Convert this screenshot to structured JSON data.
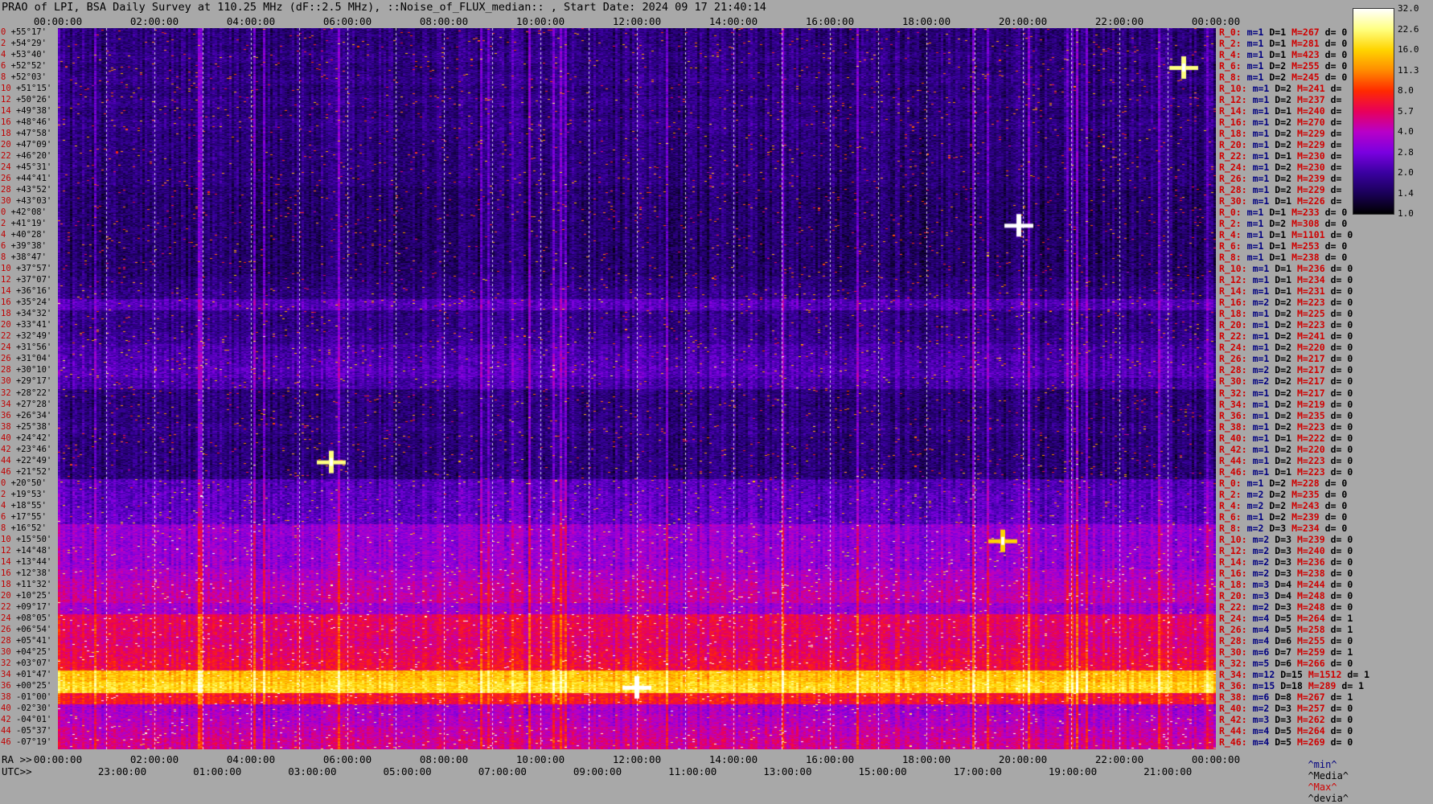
{
  "title": "PRAO of LPI, BSA Daily Survey at 110.25 MHz (dF::2.5 MHz), ::Noise_of_FLUX_median:: , Start Date: 2024 09 17 21:40:14",
  "axis": {
    "ra_label": "RA >>",
    "utc_label": "UTC>>",
    "ra_top_ticks": [
      "00:00:00",
      "02:00:00",
      "04:00:00",
      "06:00:00",
      "08:00:00",
      "10:00:00",
      "12:00:00",
      "14:00:00",
      "16:00:00",
      "18:00:00",
      "20:00:00",
      "22:00:00",
      "00:00:00"
    ],
    "ra_bottom_ticks": [
      "00:00:00",
      "02:00:00",
      "04:00:00",
      "06:00:00",
      "08:00:00",
      "10:00:00",
      "12:00:00",
      "14:00:00",
      "16:00:00",
      "18:00:00",
      "20:00:00",
      "22:00:00",
      "00:00:00"
    ],
    "utc_ticks": [
      "23:00:00",
      "01:00:00",
      "03:00:00",
      "05:00:00",
      "07:00:00",
      "09:00:00",
      "11:00:00",
      "13:00:00",
      "15:00:00",
      "17:00:00",
      "19:00:00",
      "21:00:00"
    ]
  },
  "declinations": [
    "+55°17'",
    "+54°29'",
    "+53°40'",
    "+52°52'",
    "+52°03'",
    "+51°15'",
    "+50°26'",
    "+49°38'",
    "+48°46'",
    "+47°58'",
    "+47°09'",
    "+46°20'",
    "+45°31'",
    "+44°41'",
    "+43°52'",
    "+43°03'",
    "+42°08'",
    "+41°19'",
    "+40°28'",
    "+39°38'",
    "+38°47'",
    "+37°57'",
    "+37°07'",
    "+36°16'",
    "+35°24'",
    "+34°32'",
    "+33°41'",
    "+32°49'",
    "+31°56'",
    "+31°04'",
    "+30°10'",
    "+29°17'",
    "+28°22'",
    "+27°28'",
    "+26°34'",
    "+25°38'",
    "+24°42'",
    "+23°46'",
    "+22°49'",
    "+21°52'",
    "+20°50'",
    "+19°53'",
    "+18°55'",
    "+17°55'",
    "+16°52'",
    "+15°50'",
    "+14°48'",
    "+13°44'",
    "+12°38'",
    "+11°32'",
    "+10°25'",
    "+09°17'",
    "+08°05'",
    "+06°54'",
    "+05°41'",
    "+04°25'",
    "+03°07'",
    "+01°47'",
    "+00°25'",
    "-01°00'",
    "-02°30'",
    "-04°01'",
    "-05°37'",
    "-07°19'"
  ],
  "dec_indices": [
    "0",
    "2",
    "4",
    "6",
    "8",
    "10",
    "12",
    "14",
    "16",
    "18",
    "20",
    "22",
    "24",
    "26",
    "28",
    "30",
    "0",
    "2",
    "4",
    "6",
    "8",
    "10",
    "12",
    "14",
    "16",
    "18",
    "20",
    "22",
    "24",
    "26",
    "28",
    "30",
    "32",
    "34",
    "36",
    "38",
    "40",
    "42",
    "44",
    "46",
    "0",
    "2",
    "4",
    "6",
    "8",
    "10",
    "12",
    "14",
    "16",
    "18",
    "20",
    "22",
    "24",
    "26",
    "28",
    "30",
    "32",
    "34",
    "36",
    "38",
    "40",
    "42",
    "44",
    "46"
  ],
  "stats": [
    {
      "r": "R_0:",
      "m": "m=1",
      "D": "D=1",
      "M": "M=267",
      "d": "d= 0"
    },
    {
      "r": "R_2:",
      "m": "m=1",
      "D": "D=1",
      "M": "M=281",
      "d": "d= 0"
    },
    {
      "r": "R_4:",
      "m": "m=1",
      "D": "D=1",
      "M": "M=423",
      "d": "d= 0"
    },
    {
      "r": "R_6:",
      "m": "m=1",
      "D": "D=2",
      "M": "M=255",
      "d": "d= 0"
    },
    {
      "r": "R_8:",
      "m": "m=1",
      "D": "D=2",
      "M": "M=245",
      "d": "d= 0"
    },
    {
      "r": "R_10:",
      "m": "m=1",
      "D": "D=2",
      "M": "M=241",
      "d": "d="
    },
    {
      "r": "R_12:",
      "m": "m=1",
      "D": "D=2",
      "M": "M=237",
      "d": "d="
    },
    {
      "r": "R_14:",
      "m": "m=1",
      "D": "D=1",
      "M": "M=240",
      "d": "d="
    },
    {
      "r": "R_16:",
      "m": "m=1",
      "D": "D=2",
      "M": "M=270",
      "d": "d="
    },
    {
      "r": "R_18:",
      "m": "m=1",
      "D": "D=2",
      "M": "M=229",
      "d": "d="
    },
    {
      "r": "R_20:",
      "m": "m=1",
      "D": "D=2",
      "M": "M=229",
      "d": "d="
    },
    {
      "r": "R_22:",
      "m": "m=1",
      "D": "D=1",
      "M": "M=230",
      "d": "d="
    },
    {
      "r": "R_24:",
      "m": "m=1",
      "D": "D=2",
      "M": "M=230",
      "d": "d="
    },
    {
      "r": "R_26:",
      "m": "m=1",
      "D": "D=2",
      "M": "M=239",
      "d": "d="
    },
    {
      "r": "R_28:",
      "m": "m=1",
      "D": "D=2",
      "M": "M=229",
      "d": "d="
    },
    {
      "r": "R_30:",
      "m": "m=1",
      "D": "D=1",
      "M": "M=226",
      "d": "d="
    },
    {
      "r": "R_0:",
      "m": "m=1",
      "D": "D=1",
      "M": "M=233",
      "d": "d= 0"
    },
    {
      "r": "R_2:",
      "m": "m=1",
      "D": "D=2",
      "M": "M=308",
      "d": "d= 0"
    },
    {
      "r": "R_4:",
      "m": "m=1",
      "D": "D=1",
      "M": "M=1101",
      "d": "d= 0"
    },
    {
      "r": "R_6:",
      "m": "m=1",
      "D": "D=1",
      "M": "M=253",
      "d": "d= 0"
    },
    {
      "r": "R_8:",
      "m": "m=1",
      "D": "D=1",
      "M": "M=238",
      "d": "d= 0"
    },
    {
      "r": "R_10:",
      "m": "m=1",
      "D": "D=1",
      "M": "M=236",
      "d": "d= 0"
    },
    {
      "r": "R_12:",
      "m": "m=1",
      "D": "D=1",
      "M": "M=234",
      "d": "d= 0"
    },
    {
      "r": "R_14:",
      "m": "m=1",
      "D": "D=1",
      "M": "M=231",
      "d": "d= 0"
    },
    {
      "r": "R_16:",
      "m": "m=2",
      "D": "D=2",
      "M": "M=223",
      "d": "d= 0"
    },
    {
      "r": "R_18:",
      "m": "m=1",
      "D": "D=2",
      "M": "M=225",
      "d": "d= 0"
    },
    {
      "r": "R_20:",
      "m": "m=1",
      "D": "D=2",
      "M": "M=223",
      "d": "d= 0"
    },
    {
      "r": "R_22:",
      "m": "m=1",
      "D": "D=2",
      "M": "M=241",
      "d": "d= 0"
    },
    {
      "r": "R_24:",
      "m": "m=1",
      "D": "D=2",
      "M": "M=220",
      "d": "d= 0"
    },
    {
      "r": "R_26:",
      "m": "m=1",
      "D": "D=2",
      "M": "M=217",
      "d": "d= 0"
    },
    {
      "r": "R_28:",
      "m": "m=2",
      "D": "D=2",
      "M": "M=217",
      "d": "d= 0"
    },
    {
      "r": "R_30:",
      "m": "m=2",
      "D": "D=2",
      "M": "M=217",
      "d": "d= 0"
    },
    {
      "r": "R_32:",
      "m": "m=1",
      "D": "D=2",
      "M": "M=217",
      "d": "d= 0"
    },
    {
      "r": "R_34:",
      "m": "m=1",
      "D": "D=2",
      "M": "M=219",
      "d": "d= 0"
    },
    {
      "r": "R_36:",
      "m": "m=1",
      "D": "D=2",
      "M": "M=235",
      "d": "d= 0"
    },
    {
      "r": "R_38:",
      "m": "m=1",
      "D": "D=2",
      "M": "M=223",
      "d": "d= 0"
    },
    {
      "r": "R_40:",
      "m": "m=1",
      "D": "D=1",
      "M": "M=222",
      "d": "d= 0"
    },
    {
      "r": "R_42:",
      "m": "m=1",
      "D": "D=2",
      "M": "M=220",
      "d": "d= 0"
    },
    {
      "r": "R_44:",
      "m": "m=1",
      "D": "D=2",
      "M": "M=223",
      "d": "d= 0"
    },
    {
      "r": "R_46:",
      "m": "m=1",
      "D": "D=1",
      "M": "M=223",
      "d": "d= 0"
    },
    {
      "r": "R_0:",
      "m": "m=1",
      "D": "D=2",
      "M": "M=228",
      "d": "d= 0"
    },
    {
      "r": "R_2:",
      "m": "m=2",
      "D": "D=2",
      "M": "M=235",
      "d": "d= 0"
    },
    {
      "r": "R_4:",
      "m": "m=2",
      "D": "D=2",
      "M": "M=243",
      "d": "d= 0"
    },
    {
      "r": "R_6:",
      "m": "m=1",
      "D": "D=2",
      "M": "M=239",
      "d": "d= 0"
    },
    {
      "r": "R_8:",
      "m": "m=2",
      "D": "D=3",
      "M": "M=234",
      "d": "d= 0"
    },
    {
      "r": "R_10:",
      "m": "m=2",
      "D": "D=3",
      "M": "M=239",
      "d": "d= 0"
    },
    {
      "r": "R_12:",
      "m": "m=2",
      "D": "D=3",
      "M": "M=240",
      "d": "d= 0"
    },
    {
      "r": "R_14:",
      "m": "m=2",
      "D": "D=3",
      "M": "M=236",
      "d": "d= 0"
    },
    {
      "r": "R_16:",
      "m": "m=2",
      "D": "D=3",
      "M": "M=238",
      "d": "d= 0"
    },
    {
      "r": "R_18:",
      "m": "m=3",
      "D": "D=4",
      "M": "M=244",
      "d": "d= 0"
    },
    {
      "r": "R_20:",
      "m": "m=3",
      "D": "D=4",
      "M": "M=248",
      "d": "d= 0"
    },
    {
      "r": "R_22:",
      "m": "m=2",
      "D": "D=3",
      "M": "M=248",
      "d": "d= 0"
    },
    {
      "r": "R_24:",
      "m": "m=4",
      "D": "D=5",
      "M": "M=264",
      "d": "d= 1"
    },
    {
      "r": "R_26:",
      "m": "m=4",
      "D": "D=5",
      "M": "M=258",
      "d": "d= 1"
    },
    {
      "r": "R_28:",
      "m": "m=4",
      "D": "D=6",
      "M": "M=255",
      "d": "d= 0"
    },
    {
      "r": "R_30:",
      "m": "m=6",
      "D": "D=7",
      "M": "M=259",
      "d": "d= 1"
    },
    {
      "r": "R_32:",
      "m": "m=5",
      "D": "D=6",
      "M": "M=266",
      "d": "d= 0"
    },
    {
      "r": "R_34:",
      "m": "m=12",
      "D": "D=15",
      "M": "M=1512",
      "d": "d= 1"
    },
    {
      "r": "R_36:",
      "m": "m=15",
      "D": "D=18",
      "M": "M=289",
      "d": "d= 1"
    },
    {
      "r": "R_38:",
      "m": "m=6",
      "D": "D=8",
      "M": "M=267",
      "d": "d= 1"
    },
    {
      "r": "R_40:",
      "m": "m=2",
      "D": "D=3",
      "M": "M=257",
      "d": "d= 0"
    },
    {
      "r": "R_42:",
      "m": "m=3",
      "D": "D=3",
      "M": "M=262",
      "d": "d= 0"
    },
    {
      "r": "R_44:",
      "m": "m=4",
      "D": "D=5",
      "M": "M=264",
      "d": "d= 0"
    },
    {
      "r": "R_46:",
      "m": "m=4",
      "D": "D=5",
      "M": "M=269",
      "d": "d= 0"
    }
  ],
  "legend": {
    "min": "^min^",
    "median": "^Media^",
    "max": "^Max^",
    "devia": "^devia^"
  },
  "colorbar": {
    "ticks": [
      "32.0",
      "22.6",
      "16.0",
      "11.3",
      "8.0",
      "5.7",
      "4.0",
      "2.8",
      "2.0",
      "1.4",
      "1.0"
    ],
    "colors": [
      "#000000",
      "#1a0058",
      "#3a00a0",
      "#7a00e0",
      "#b800c8",
      "#e8005a",
      "#ff2a00",
      "#ff8c00",
      "#ffd400",
      "#ffff80",
      "#ffffff"
    ]
  },
  "chart_data": {
    "type": "heatmap",
    "title": "PRAO of LPI, BSA Daily Survey at 110.25 MHz (dF::2.5 MHz), ::Noise_of_FLUX_median:: , Start Date: 2024 09 17 21:40:14",
    "x_axis": "RA 00:00:00 to 00:00:00 (top), UTC 23:00:00 to 21:00:00 (bottom)",
    "y_axis": "Declination +55°17' to -07°19'",
    "color_scale": {
      "type": "log",
      "min": 1.0,
      "max": 32.0
    },
    "row_levels": [
      1.6,
      1.6,
      1.7,
      1.6,
      1.7,
      1.6,
      1.7,
      1.6,
      1.7,
      1.6,
      1.6,
      1.6,
      1.6,
      1.6,
      1.5,
      1.5,
      1.5,
      1.5,
      1.5,
      1.5,
      1.5,
      1.5,
      1.6,
      1.7,
      2.2,
      1.7,
      1.7,
      1.8,
      2.0,
      2.1,
      2.2,
      2.0,
      1.6,
      1.6,
      1.6,
      1.7,
      1.6,
      1.6,
      1.6,
      1.6,
      2.2,
      2.3,
      2.3,
      2.4,
      3.2,
      3.1,
      3.2,
      3.2,
      3.6,
      4.0,
      4.2,
      3.4,
      5.4,
      5.3,
      5.0,
      5.5,
      6.0,
      14.0,
      16.0,
      6.5,
      3.5,
      3.8,
      4.2,
      4.6
    ],
    "bright_sources": [
      {
        "ra": "19:55",
        "dec": "+41°19'",
        "level": 32.0
      },
      {
        "ra": "12:00",
        "dec": "+00°25'",
        "level": 32.0
      },
      {
        "ra": "05:40",
        "dec": "+22°49'",
        "level": 22.6
      },
      {
        "ra": "19:35",
        "dec": "+15°50'",
        "level": 16.0
      },
      {
        "ra": "23:20",
        "dec": "+52°52'",
        "level": 22.6
      }
    ]
  }
}
